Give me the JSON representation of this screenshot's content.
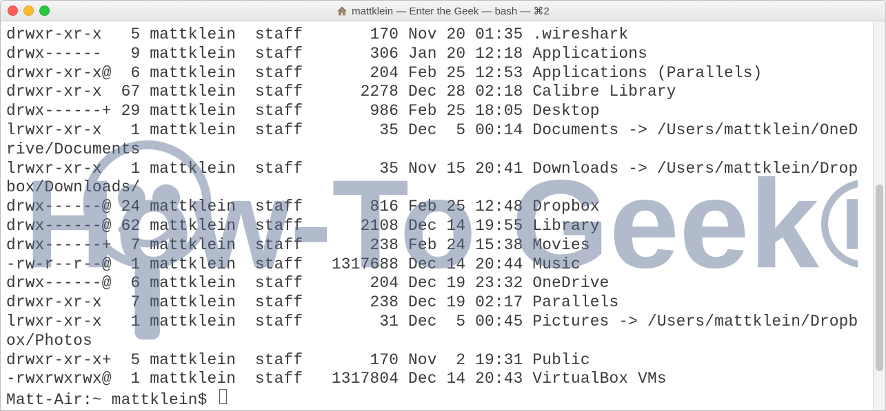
{
  "window": {
    "title_parts": [
      "mattklein",
      "—",
      "Enter the Geek",
      "—",
      "bash",
      "—",
      "⌘2"
    ],
    "title": "mattklein — Enter the Geek — bash — ⌘2"
  },
  "watermark_text": "How-To Geek®",
  "listing": [
    {
      "perm": "drwxr-xr-x ",
      "links": "5",
      "owner": "mattklein",
      "group": "staff",
      "size": "170",
      "month": "Nov",
      "day": "20",
      "time": "01:35",
      "name": ".wireshark"
    },
    {
      "perm": "drwx------ ",
      "links": "9",
      "owner": "mattklein",
      "group": "staff",
      "size": "306",
      "month": "Jan",
      "day": "20",
      "time": "12:18",
      "name": "Applications"
    },
    {
      "perm": "drwxr-xr-x@",
      "links": "6",
      "owner": "mattklein",
      "group": "staff",
      "size": "204",
      "month": "Feb",
      "day": "25",
      "time": "12:53",
      "name": "Applications (Parallels)"
    },
    {
      "perm": "drwxr-xr-x ",
      "links": "67",
      "owner": "mattklein",
      "group": "staff",
      "size": "2278",
      "month": "Dec",
      "day": "28",
      "time": "02:18",
      "name": "Calibre Library"
    },
    {
      "perm": "drwx------+",
      "links": "29",
      "owner": "mattklein",
      "group": "staff",
      "size": "986",
      "month": "Feb",
      "day": "25",
      "time": "18:05",
      "name": "Desktop"
    },
    {
      "perm": "lrwxr-xr-x ",
      "links": "1",
      "owner": "mattklein",
      "group": "staff",
      "size": "35",
      "month": "Dec",
      "day": "5",
      "time": "00:14",
      "name": "Documents -> /Users/mattklein/OneDrive/Documents"
    },
    {
      "perm": "lrwxr-xr-x ",
      "links": "1",
      "owner": "mattklein",
      "group": "staff",
      "size": "35",
      "month": "Nov",
      "day": "15",
      "time": "20:41",
      "name": "Downloads -> /Users/mattklein/Dropbox/Downloads/"
    },
    {
      "perm": "drwx------@",
      "links": "24",
      "owner": "mattklein",
      "group": "staff",
      "size": "816",
      "month": "Feb",
      "day": "25",
      "time": "12:48",
      "name": "Dropbox"
    },
    {
      "perm": "drwx------@",
      "links": "62",
      "owner": "mattklein",
      "group": "staff",
      "size": "2108",
      "month": "Dec",
      "day": "14",
      "time": "19:55",
      "name": "Library"
    },
    {
      "perm": "drwx------+",
      "links": "7",
      "owner": "mattklein",
      "group": "staff",
      "size": "238",
      "month": "Feb",
      "day": "24",
      "time": "15:38",
      "name": "Movies"
    },
    {
      "perm": "-rw-r--r--@",
      "links": "1",
      "owner": "mattklein",
      "group": "staff",
      "size": "1317688",
      "month": "Dec",
      "day": "14",
      "time": "20:44",
      "name": "Music"
    },
    {
      "perm": "drwx------@",
      "links": "6",
      "owner": "mattklein",
      "group": "staff",
      "size": "204",
      "month": "Dec",
      "day": "19",
      "time": "23:32",
      "name": "OneDrive"
    },
    {
      "perm": "drwxr-xr-x ",
      "links": "7",
      "owner": "mattklein",
      "group": "staff",
      "size": "238",
      "month": "Dec",
      "day": "19",
      "time": "02:17",
      "name": "Parallels"
    },
    {
      "perm": "lrwxr-xr-x ",
      "links": "1",
      "owner": "mattklein",
      "group": "staff",
      "size": "31",
      "month": "Dec",
      "day": "5",
      "time": "00:45",
      "name": "Pictures -> /Users/mattklein/Dropbox/Photos"
    },
    {
      "perm": "drwxr-xr-x+",
      "links": "5",
      "owner": "mattklein",
      "group": "staff",
      "size": "170",
      "month": "Nov",
      "day": "2",
      "time": "19:31",
      "name": "Public"
    },
    {
      "perm": "-rwxrwxrwx@",
      "links": "1",
      "owner": "mattklein",
      "group": "staff",
      "size": "1317804",
      "month": "Dec",
      "day": "14",
      "time": "20:43",
      "name": "VirtualBox VMs"
    }
  ],
  "prompt": {
    "host": "Matt-Air",
    "path": "~",
    "user": "mattklein",
    "full": "Matt-Air:~ mattklein$"
  }
}
